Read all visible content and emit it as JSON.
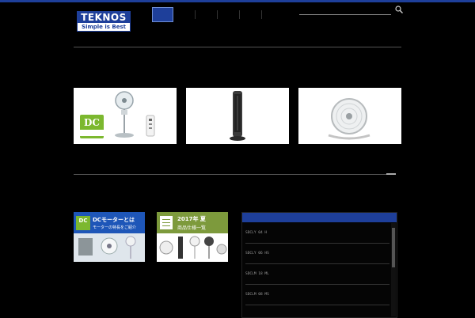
{
  "brand": {
    "name": "TEKNOS",
    "tagline": "Simple is Best",
    "accent": "#1e3f9a",
    "green": "#7cb82f"
  },
  "nav": {
    "items": [
      {
        "label": ""
      },
      {
        "label": ""
      },
      {
        "label": ""
      },
      {
        "label": ""
      },
      {
        "label": ""
      },
      {
        "label": ""
      }
    ]
  },
  "search": {
    "placeholder": ""
  },
  "sections": {
    "recommended": "",
    "topics": ""
  },
  "products": [
    {
      "caption": "",
      "badge": "DC",
      "image": "dc-stand-fan-with-remote"
    },
    {
      "caption": "",
      "image": "tower-fan"
    },
    {
      "caption": "",
      "image": "circulator-fan"
    }
  ],
  "topics": [
    {
      "banner_title": "DCモーターとは",
      "banner_sub": "モーターの特長をご紹介",
      "badge": "DC",
      "text": ""
    },
    {
      "banner_title": "2017年 夏",
      "banner_sub": "商品仕様一覧",
      "text": ""
    }
  ],
  "news": {
    "title": "",
    "items": [
      {
        "label": "SDCLY 04 H"
      },
      {
        "label": "SDCLY 06 HS"
      },
      {
        "label": "SDCLM 18 ML"
      },
      {
        "label": "SDCLM 08 MS"
      }
    ]
  }
}
